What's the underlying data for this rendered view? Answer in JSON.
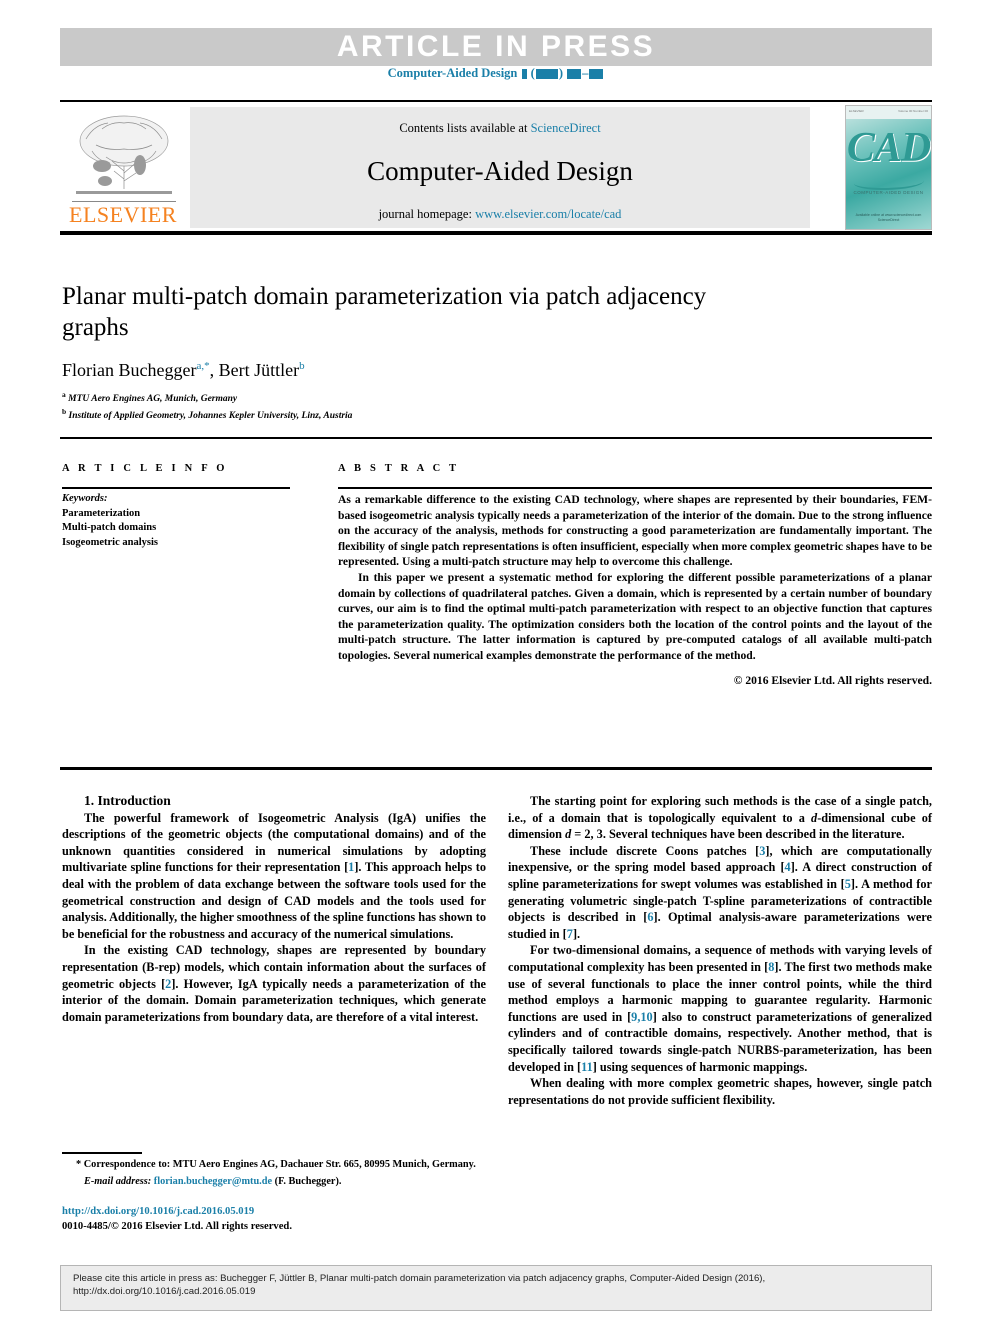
{
  "banner": {
    "text": "ARTICLE IN PRESS",
    "journal_ref_prefix": "Computer-Aided Design",
    "accent_color": "#1a7fa8",
    "band_color": "#c9c9c9"
  },
  "masthead": {
    "contents_prefix": "Contents lists available at ",
    "contents_link": "ScienceDirect",
    "journal_title": "Computer-Aided Design",
    "homepage_prefix": "journal homepage: ",
    "homepage_link": "www.elsevier.com/locate/cad",
    "publisher_logo_text": "ELSEVIER",
    "publisher_logo_color": "#f58220",
    "cover": {
      "letters": "CAD",
      "subtitle": "COMPUTER-AIDED DESIGN",
      "top_left_label": "ELSEVIER",
      "top_right_label": "Volume 00  Number 00",
      "bottom_label": "Available online at www.sciencedirect.com",
      "bottom_label2": "ScienceDirect"
    }
  },
  "article": {
    "title": "Planar multi-patch domain parameterization via patch adjacency graphs",
    "authors": [
      {
        "name": "Florian Buchegger",
        "marks": "a,*"
      },
      {
        "name": "Bert Jüttler",
        "marks": "b"
      }
    ],
    "affiliations": [
      {
        "mark": "a",
        "text": "MTU Aero Engines AG, Munich, Germany"
      },
      {
        "mark": "b",
        "text": "Institute of Applied Geometry, Johannes Kepler University, Linz, Austria"
      }
    ]
  },
  "article_info": {
    "heading": "A R T I C L E    I N F O",
    "keywords_label": "Keywords:",
    "keywords": [
      "Parameterization",
      "Multi-patch domains",
      "Isogeometric analysis"
    ]
  },
  "abstract": {
    "heading": "A B S T R A C T",
    "paragraphs": [
      "As a remarkable difference to the existing CAD technology, where shapes are represented by their boundaries, FEM-based isogeometric analysis typically needs a parameterization of the interior of the domain. Due to the strong influence on the accuracy of the analysis, methods for constructing a good parameterization are fundamentally important. The flexibility of single patch representations is often insufficient, especially when more complex geometric shapes have to be represented. Using a multi-patch structure may help to overcome this challenge.",
      "In this paper we present a systematic method for exploring the different possible parameterizations of a planar domain by collections of quadrilateral patches. Given a domain, which is represented by a certain number of boundary curves, our aim is to find the optimal multi-patch parameterization with respect to an objective function that captures the parameterization quality. The optimization considers both the location of the control points and the layout of the multi-patch structure. The latter information is captured by pre-computed catalogs of all available multi-patch topologies. Several numerical examples demonstrate the performance of the method."
    ],
    "copyright": "© 2016 Elsevier Ltd. All rights reserved."
  },
  "body": {
    "section_number": "1.",
    "section_title": "Introduction",
    "left_paragraphs": [
      "The powerful framework of Isogeometric Analysis (IgA) unifies the descriptions of the geometric objects (the computational domains) and of the unknown quantities considered in numerical simulations by adopting multivariate spline functions for their representation [1]. This approach helps to deal with the problem of data exchange between the software tools used for the geometrical construction and design of CAD models and the tools used for analysis. Additionally, the higher smoothness of the spline functions has shown to be beneficial for the robustness and accuracy of the numerical simulations.",
      "In the existing CAD technology, shapes are represented by boundary representation (B-rep) models, which contain information about the surfaces of geometric objects [2]. However, IgA typically needs a parameterization of the interior of the domain. Domain parameterization techniques, which generate domain parameterizations from boundary data, are therefore of a vital interest."
    ],
    "right_paragraphs": [
      "The starting point for exploring such methods is the case of a single patch, i.e., of a domain that is topologically equivalent to a d-dimensional cube of dimension d = 2, 3. Several techniques have been described in the literature.",
      "These include discrete Coons patches [3], which are computationally inexpensive, or the spring model based approach [4]. A direct construction of spline parameterizations for swept volumes was established in [5]. A method for generating volumetric single-patch T-spline parameterizations of contractible objects is described in [6]. Optimal analysis-aware parameterizations were studied in [7].",
      "For two-dimensional domains, a sequence of methods with varying levels of computational complexity has been presented in [8]. The first two methods make use of several functionals to place the inner control points, while the third method employs a harmonic mapping to guarantee regularity. Harmonic functions are used in [9,10] also to construct parameterizations of generalized cylinders and of contractible domains, respectively. Another method, that is specifically tailored towards single-patch NURBS-parameterization, has been developed in [11] using sequences of harmonic mappings.",
      "When dealing with more complex geometric shapes, however, single patch representations do not provide sufficient flexibility."
    ]
  },
  "footnote": {
    "correspondence": "Correspondence to: MTU Aero Engines AG, Dachauer Str. 665, 80995 Munich, Germany.",
    "email_label": "E-mail address:",
    "email": "florian.buchegger@mtu.de",
    "email_owner": "(F. Buchegger).",
    "doi_url": "http://dx.doi.org/10.1016/j.cad.2016.05.019",
    "issn_line": "0010-4485/© 2016 Elsevier Ltd. All rights reserved."
  },
  "cite_box": {
    "line1": "Please cite this article in press as: Buchegger F, Jüttler B, Planar multi-patch domain parameterization via patch adjacency graphs, Computer-Aided Design (2016),",
    "line2": "http://dx.doi.org/10.1016/j.cad.2016.05.019"
  }
}
